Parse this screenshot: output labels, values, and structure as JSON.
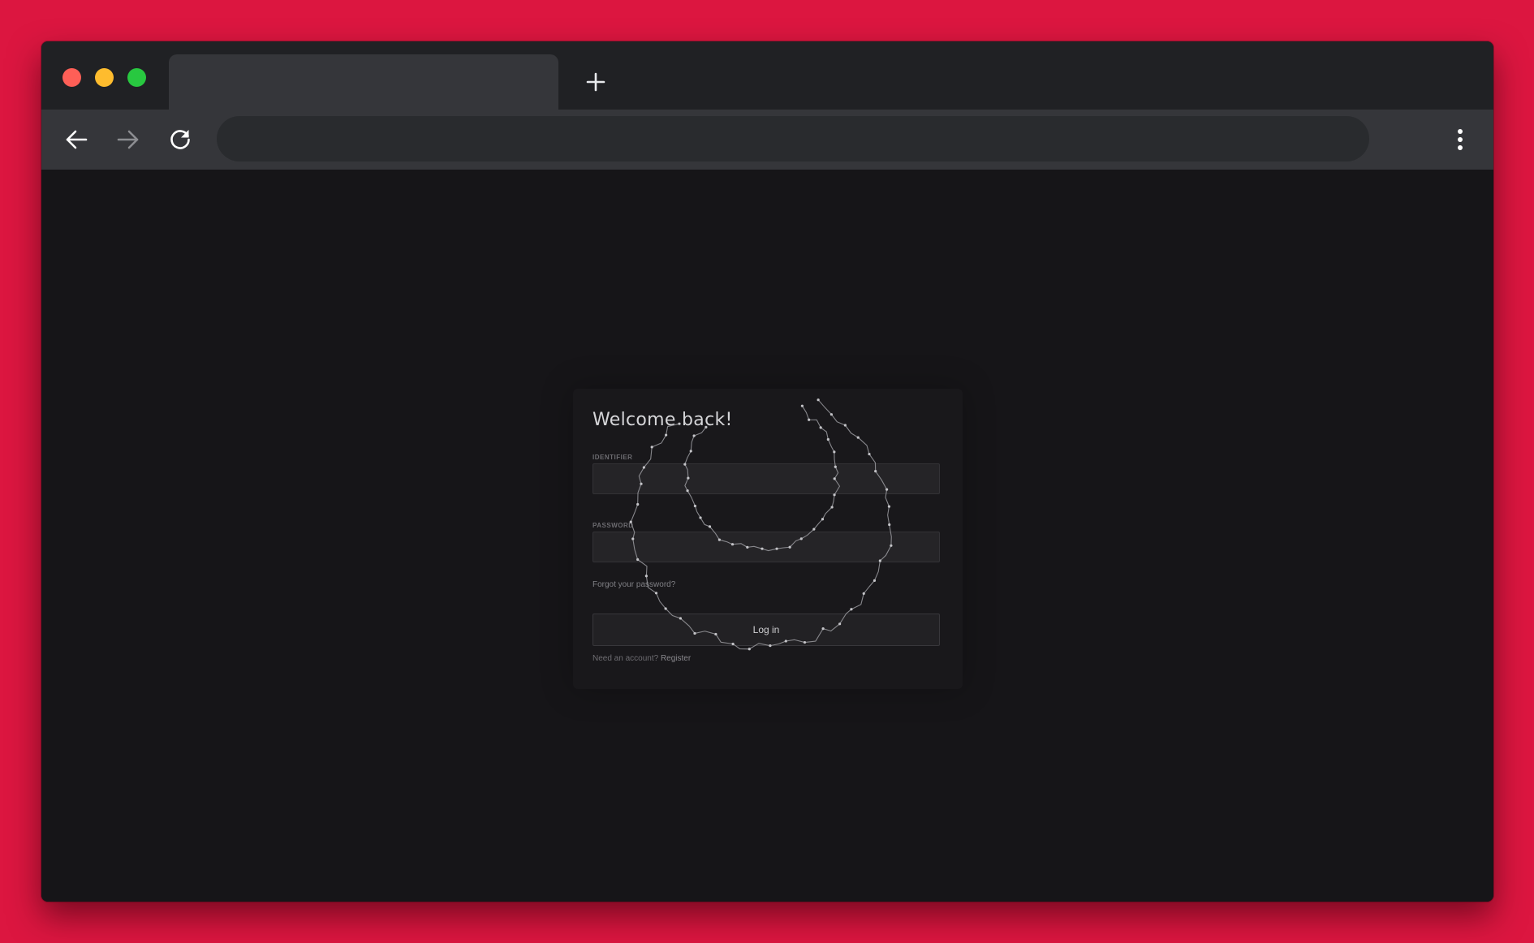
{
  "browser": {
    "tab_title": "",
    "address": "",
    "icons": {
      "new_tab": "plus-icon",
      "back": "arrow-left-icon",
      "forward": "arrow-right-icon",
      "reload": "reload-icon",
      "menu": "kebab-menu-icon"
    }
  },
  "login": {
    "heading": "Welcome back!",
    "identifier_label": "IDENTIFIER",
    "identifier_value": "",
    "password_label": "PASSWORD",
    "password_value": "",
    "forgot_link": "Forgot your password?",
    "submit_label": "Log in",
    "register_prompt": "Need an account?",
    "register_link": "Register"
  },
  "colors": {
    "backdrop": "#dc1640",
    "titlebar": "#202124",
    "toolbar": "#35363a",
    "page_background": "#161518",
    "close_button": "#fe5f57",
    "minimize_button": "#febc2e",
    "maximize_button": "#28c840"
  }
}
